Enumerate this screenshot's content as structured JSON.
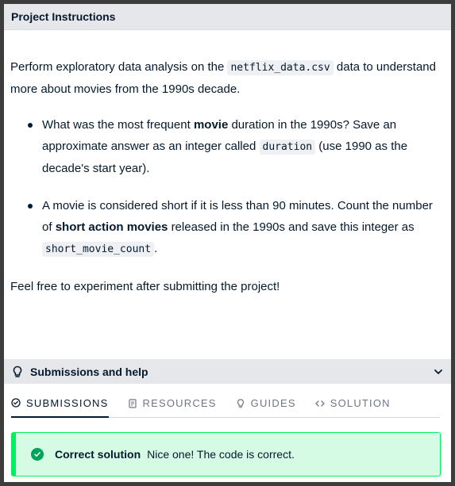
{
  "header": {
    "title": "Project Instructions"
  },
  "instructions": {
    "intro_prefix": "Perform exploratory data analysis on the",
    "intro_code": "netflix_data.csv",
    "intro_suffix": "data to understand more about movies from the 1990s decade.",
    "bullets": [
      {
        "a": "What was the most frequent",
        "b": "movie",
        "c": "duration in the 1990s? Save an approximate answer as an integer called",
        "code": "duration",
        "d": "(use 1990 as the decade's start year)."
      },
      {
        "a": "A movie is considered short if it is less than 90 minutes. Count the number of",
        "b": "short action movies",
        "c": "released in the 1990s and save this integer as",
        "code": "short_movie_count",
        "d": "."
      }
    ],
    "closing": "Feel free to experiment after submitting the project!"
  },
  "submissions_panel": {
    "title": "Submissions and help"
  },
  "tabs": [
    {
      "label": "SUBMISSIONS",
      "icon": "check-circle-icon",
      "active": true
    },
    {
      "label": "RESOURCES",
      "icon": "document-icon",
      "active": false
    },
    {
      "label": "GUIDES",
      "icon": "lightbulb-icon",
      "active": false
    },
    {
      "label": "SOLUTION",
      "icon": "code-icon",
      "active": false
    }
  ],
  "result": {
    "title": "Correct solution",
    "message": "Nice one! The code is correct.",
    "status_color": "#03ef62"
  },
  "colors": {
    "text": "#05192d",
    "header_bg": "#e6e7eb",
    "success_bg": "#d5fbe5",
    "success_accent": "#03ef62"
  }
}
